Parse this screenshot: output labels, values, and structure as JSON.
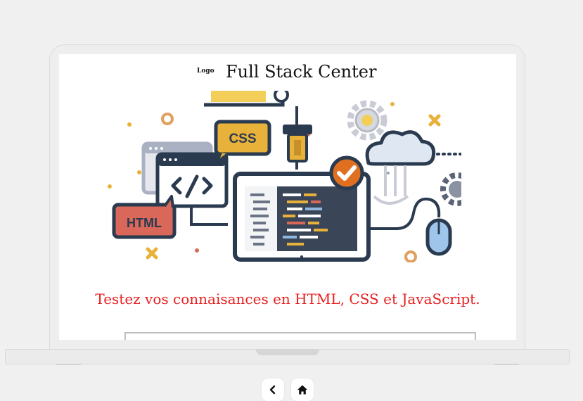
{
  "header": {
    "logo_text": "Logo",
    "site_title": "Full Stack Center"
  },
  "hero": {
    "badge_css": "CSS",
    "badge_html": "HTML"
  },
  "main": {
    "tagline": "Testez vos connaisances en HTML, CSS et JavaScript."
  },
  "nav": {
    "back_icon": "chevron-left-icon",
    "home_icon": "home-icon"
  },
  "colors": {
    "background": "#f0f0f0",
    "tagline": "#e81f1f",
    "accent_orange": "#e0701f",
    "accent_yellow": "#e8b23a",
    "badge_html": "#d9685a",
    "navy": "#2a3a4f"
  }
}
